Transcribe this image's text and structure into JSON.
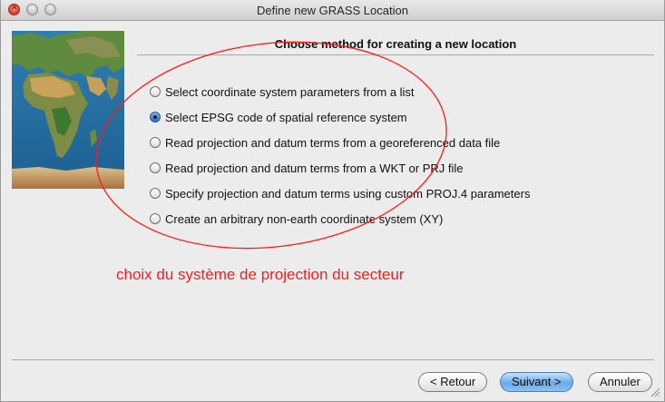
{
  "window": {
    "title": "Define new GRASS Location"
  },
  "page": {
    "heading": "Choose method for creating a new location"
  },
  "options": [
    {
      "label": "Select coordinate system parameters from a list",
      "checked": false
    },
    {
      "label": "Select EPSG code of spatial reference system",
      "checked": true
    },
    {
      "label": "Read projection and datum terms from a georeferenced data file",
      "checked": false
    },
    {
      "label": "Read projection and datum terms from a WKT or PRJ file",
      "checked": false
    },
    {
      "label": "Specify projection and datum terms using custom PROJ.4 parameters",
      "checked": false
    },
    {
      "label": "Create an arbitrary non-earth coordinate system (XY)",
      "checked": false
    }
  ],
  "annotation": {
    "text": "choix du système de projection du secteur",
    "color": "#ff1a1a"
  },
  "buttons": {
    "back": "< Retour",
    "next": "Suivant >",
    "cancel": "Annuler"
  },
  "icons": {
    "map": "world-map-image",
    "close": "close-icon",
    "minimize": "minimize-icon",
    "zoom": "zoom-icon",
    "resize": "resize-grip-icon"
  }
}
